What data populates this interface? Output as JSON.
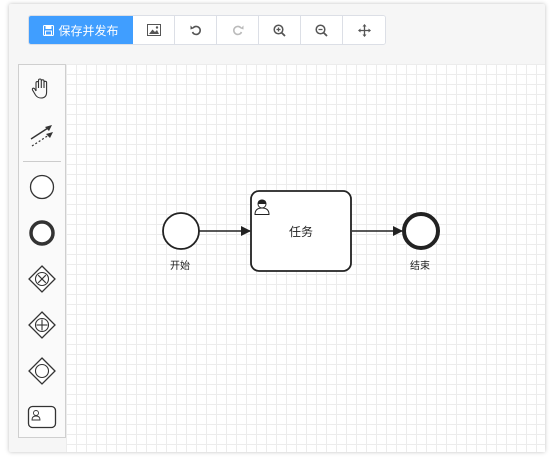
{
  "toolbar": {
    "save_label": "保存并发布",
    "icons": [
      "image-icon",
      "undo-icon",
      "redo-icon",
      "zoom-in-icon",
      "zoom-out-icon",
      "move-icon"
    ]
  },
  "palette": {
    "tools": [
      "hand-tool",
      "global-connect-tool",
      "start-event",
      "end-event",
      "exclusive-gateway",
      "parallel-gateway",
      "inclusive-gateway",
      "user-task"
    ]
  },
  "diagram": {
    "start_label": "开始",
    "task_label": "任务",
    "end_label": "结束"
  },
  "colors": {
    "primary": "#409eff",
    "stroke": "#222222"
  }
}
